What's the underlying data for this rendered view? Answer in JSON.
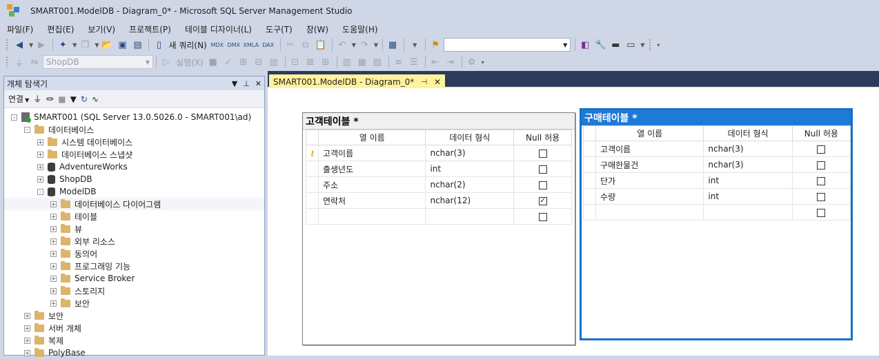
{
  "window": {
    "title": "SMART001.ModelDB - Diagram_0* - Microsoft SQL Server Management Studio"
  },
  "menu": [
    "파일(F)",
    "편집(E)",
    "보기(V)",
    "프로젝트(P)",
    "테이블 디자이너(L)",
    "도구(T)",
    "창(W)",
    "도움말(H)"
  ],
  "toolbar1": {
    "new_query_label": "새 쿼리(N)",
    "query_type_labels": [
      "MDX",
      "DMX",
      "XMLA",
      "DAX"
    ],
    "search_value": ""
  },
  "toolbar2": {
    "database_selected": "ShopDB",
    "execute_label": "실행(X)"
  },
  "object_explorer": {
    "title": "개체 탐색기",
    "connect_label": "연결",
    "tree": [
      {
        "label": "SMART001 (SQL Server 13.0.5026.0 - SMART001\\ad)",
        "indent": 0,
        "icon": "server",
        "expander": "-"
      },
      {
        "label": "데이터베이스",
        "indent": 1,
        "icon": "folder",
        "expander": "-"
      },
      {
        "label": "시스템 데이터베이스",
        "indent": 2,
        "icon": "folder",
        "expander": "+"
      },
      {
        "label": "데이터베이스 스냅샷",
        "indent": 2,
        "icon": "folder",
        "expander": "+"
      },
      {
        "label": "AdventureWorks",
        "indent": 2,
        "icon": "db",
        "expander": "+"
      },
      {
        "label": "ShopDB",
        "indent": 2,
        "icon": "db",
        "expander": "+"
      },
      {
        "label": "ModelDB",
        "indent": 2,
        "icon": "db",
        "expander": "-"
      },
      {
        "label": "데이터베이스 다이어그램",
        "indent": 3,
        "icon": "folder",
        "expander": "+",
        "selected": true
      },
      {
        "label": "테이블",
        "indent": 3,
        "icon": "folder",
        "expander": "+"
      },
      {
        "label": "뷰",
        "indent": 3,
        "icon": "folder",
        "expander": "+"
      },
      {
        "label": "외부 리소스",
        "indent": 3,
        "icon": "folder",
        "expander": "+"
      },
      {
        "label": "동의어",
        "indent": 3,
        "icon": "folder",
        "expander": "+"
      },
      {
        "label": "프로그래밍 기능",
        "indent": 3,
        "icon": "folder",
        "expander": "+"
      },
      {
        "label": "Service Broker",
        "indent": 3,
        "icon": "folder",
        "expander": "+"
      },
      {
        "label": "스토리지",
        "indent": 3,
        "icon": "folder",
        "expander": "+"
      },
      {
        "label": "보안",
        "indent": 3,
        "icon": "folder",
        "expander": "+"
      },
      {
        "label": "보안",
        "indent": 1,
        "icon": "folder",
        "expander": "+"
      },
      {
        "label": "서버 개체",
        "indent": 1,
        "icon": "folder",
        "expander": "+"
      },
      {
        "label": "복제",
        "indent": 1,
        "icon": "folder",
        "expander": "+"
      },
      {
        "label": "PolyBase",
        "indent": 1,
        "icon": "folder",
        "expander": "+"
      }
    ]
  },
  "document_tab": {
    "label": "SMART001.ModelDB - Diagram_0*"
  },
  "diagram": {
    "columns_header": [
      "열 이름",
      "데이터 형식",
      "Null 허용"
    ],
    "tables": [
      {
        "title": "고객테이블 *",
        "rows": [
          {
            "name": "고객이름",
            "type": "nchar(3)",
            "nullable": false,
            "pk": true
          },
          {
            "name": "출생년도",
            "type": "int",
            "nullable": false,
            "pk": false
          },
          {
            "name": "주소",
            "type": "nchar(2)",
            "nullable": false,
            "pk": false
          },
          {
            "name": "연락처",
            "type": "nchar(12)",
            "nullable": true,
            "pk": false
          },
          {
            "name": "",
            "type": "",
            "nullable": false,
            "pk": false
          }
        ]
      },
      {
        "title": "구매테이블 *",
        "rows": [
          {
            "name": "고객이름",
            "type": "nchar(3)",
            "nullable": false,
            "pk": false
          },
          {
            "name": "구매한물건",
            "type": "nchar(3)",
            "nullable": false,
            "pk": false
          },
          {
            "name": "단가",
            "type": "int",
            "nullable": false,
            "pk": false
          },
          {
            "name": "수량",
            "type": "int",
            "nullable": false,
            "pk": false
          },
          {
            "name": "",
            "type": "",
            "nullable": false,
            "pk": false
          }
        ]
      }
    ]
  }
}
